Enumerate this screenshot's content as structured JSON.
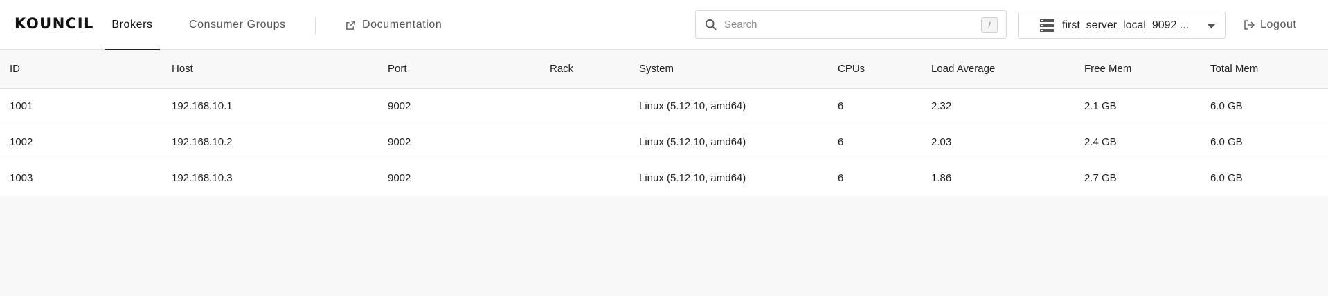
{
  "app": {
    "logo": "KOUNCIL"
  },
  "nav": {
    "tabs": [
      {
        "label": "Brokers",
        "active": true
      },
      {
        "label": "Consumer Groups",
        "active": false
      }
    ],
    "documentation_label": "Documentation"
  },
  "search": {
    "placeholder": "Search",
    "value": "",
    "shortcut": "/"
  },
  "server_selector": {
    "selected": "first_server_local_9092 ..."
  },
  "logout_label": "Logout",
  "icons": {
    "search": "search-icon",
    "external_link": "external-link-icon",
    "server": "server-icon",
    "dropdown": "chevron-down-icon",
    "logout": "logout-icon"
  },
  "table": {
    "columns": [
      "ID",
      "Host",
      "Port",
      "Rack",
      "System",
      "CPUs",
      "Load Average",
      "Free Mem",
      "Total Mem"
    ],
    "rows": [
      [
        "1001",
        "192.168.10.1",
        "9002",
        "",
        "Linux (5.12.10, amd64)",
        "6",
        "2.32",
        "2.1 GB",
        "6.0 GB"
      ],
      [
        "1002",
        "192.168.10.2",
        "9002",
        "",
        "Linux (5.12.10, amd64)",
        "6",
        "2.03",
        "2.4 GB",
        "6.0 GB"
      ],
      [
        "1003",
        "192.168.10.3",
        "9002",
        "",
        "Linux (5.12.10, amd64)",
        "6",
        "1.86",
        "2.7 GB",
        "6.0 GB"
      ]
    ]
  },
  "colors": {
    "background": "#f8f8f8",
    "header_bg": "#ffffff",
    "text": "#222222"
  }
}
